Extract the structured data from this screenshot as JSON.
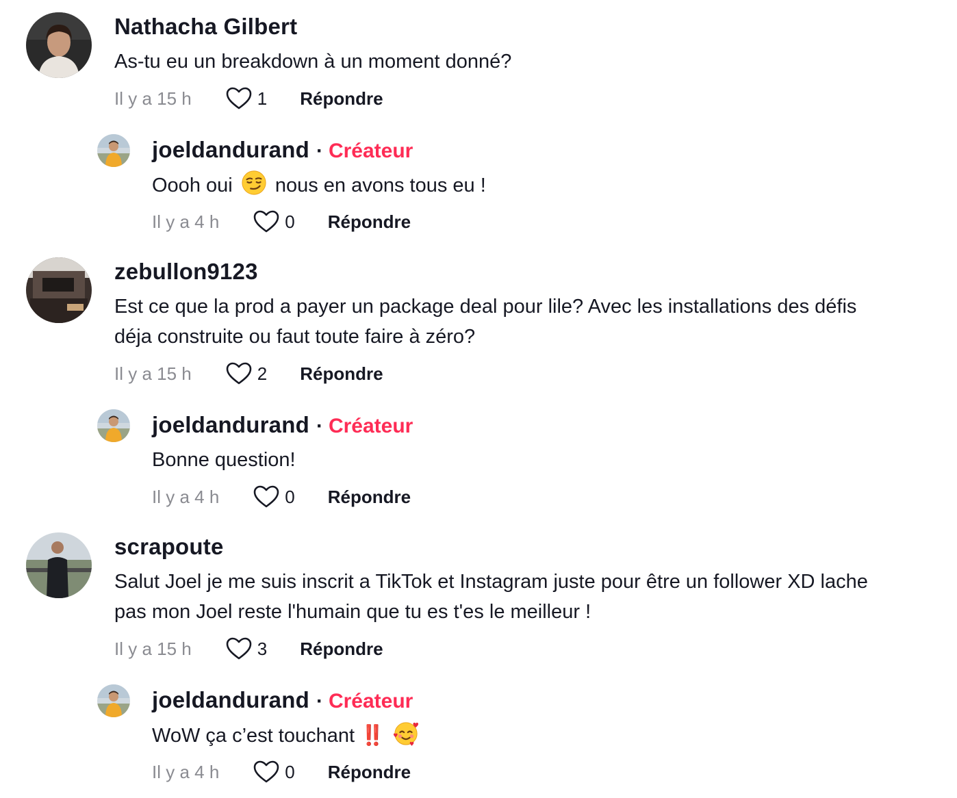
{
  "comments": [
    {
      "author": "Nathacha Gilbert",
      "text": "As-tu eu un breakdown à un moment donné?",
      "time": "Il y a 15 h",
      "likes": "1",
      "reply_label": "Répondre",
      "reply": {
        "author": "joeldandurand",
        "separator": "·",
        "badge": "Créateur",
        "text_before": "Oooh oui",
        "emoji": "smirking-face",
        "text_after": "nous en avons tous eu !",
        "time": "Il y a 4 h",
        "likes": "0",
        "reply_label": "Répondre"
      }
    },
    {
      "author": "zebullon9123",
      "text_line1": "Est ce que la prod a payer un package deal pour lile? Avec les installations des défis",
      "text_line2": "déja construite ou faut toute faire à zéro?",
      "time": "Il y a 15 h",
      "likes": "2",
      "reply_label": "Répondre",
      "reply": {
        "author": "joeldandurand",
        "separator": "·",
        "badge": "Créateur",
        "text": "Bonne question!",
        "time": "Il y a 4 h",
        "likes": "0",
        "reply_label": "Répondre"
      }
    },
    {
      "author": "scrapoute",
      "text_line1": "Salut Joel je me suis inscrit a TikTok et Instagram juste pour être un follower XD lache",
      "text_line2": "pas mon Joel reste l'humain que tu es t'es le meilleur !",
      "time": "Il y a 15 h",
      "likes": "3",
      "reply_label": "Répondre",
      "reply": {
        "author": "joeldandurand",
        "separator": "·",
        "badge": "Créateur",
        "text": "WoW ça c’est touchant ‼️",
        "emoji": "smiling-face-with-hearts",
        "time": "Il y a 4 h",
        "likes": "0",
        "reply_label": "Répondre"
      }
    }
  ],
  "colors": {
    "creator_badge": "#fe2c55",
    "text": "#161823",
    "meta": "#8a8b91"
  }
}
